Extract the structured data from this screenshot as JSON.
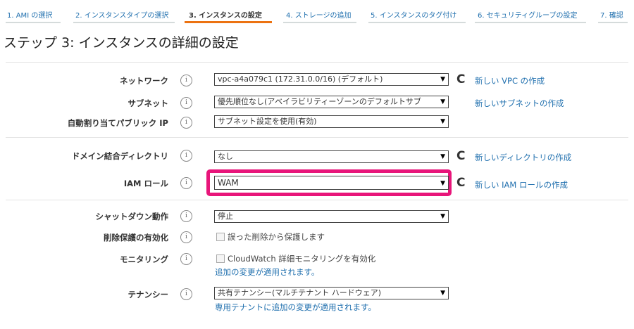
{
  "wizard": {
    "steps": [
      {
        "label": "1. AMI の選択"
      },
      {
        "label": "2. インスタンスタイプの選択"
      },
      {
        "label": "3. インスタンスの設定"
      },
      {
        "label": "4. ストレージの追加"
      },
      {
        "label": "5. インスタンスのタグ付け"
      },
      {
        "label": "6. セキュリティグループの設定"
      },
      {
        "label": "7. 確認"
      }
    ],
    "active_step": 3,
    "accent_color": "#ec7211"
  },
  "page": {
    "title": "ステップ 3: インスタンスの詳細の設定"
  },
  "form": {
    "network": {
      "label": "ネットワーク",
      "value": "vpc-a4a079c1 (172.31.0.0/16) (デフォルト)",
      "link": "新しい VPC の作成"
    },
    "subnet": {
      "label": "サブネット",
      "value": "優先順位なし(アベイラビリティーゾーンのデフォルトサブ",
      "link": "新しいサブネットの作成"
    },
    "public_ip": {
      "label": "自動割り当てパブリック IP",
      "value": "サブネット設定を使用(有効)"
    },
    "domain": {
      "label": "ドメイン結合ディレクトリ",
      "value": "なし",
      "link": "新しいディレクトリの作成"
    },
    "iam_role": {
      "label": "IAM ロール",
      "value": "WAM",
      "link": "新しい IAM ロールの作成",
      "highlight_color": "#e8157a"
    },
    "shutdown": {
      "label": "シャットダウン動作",
      "value": "停止"
    },
    "termination": {
      "label": "削除保護の有効化",
      "checkbox_label": "誤った削除から保護します"
    },
    "monitoring": {
      "label": "モニタリング",
      "checkbox_label": "CloudWatch 詳細モニタリングを有効化",
      "note": "追加の変更が適用されます。"
    },
    "tenancy": {
      "label": "テナンシー",
      "value": "共有テナンシー(マルチテナント ハードウェア)",
      "note": "専用テナントに追加の変更が適用されます。"
    }
  },
  "icons": {
    "info": "info-icon",
    "refresh": "refresh-icon",
    "caret": "caret-down-icon"
  }
}
